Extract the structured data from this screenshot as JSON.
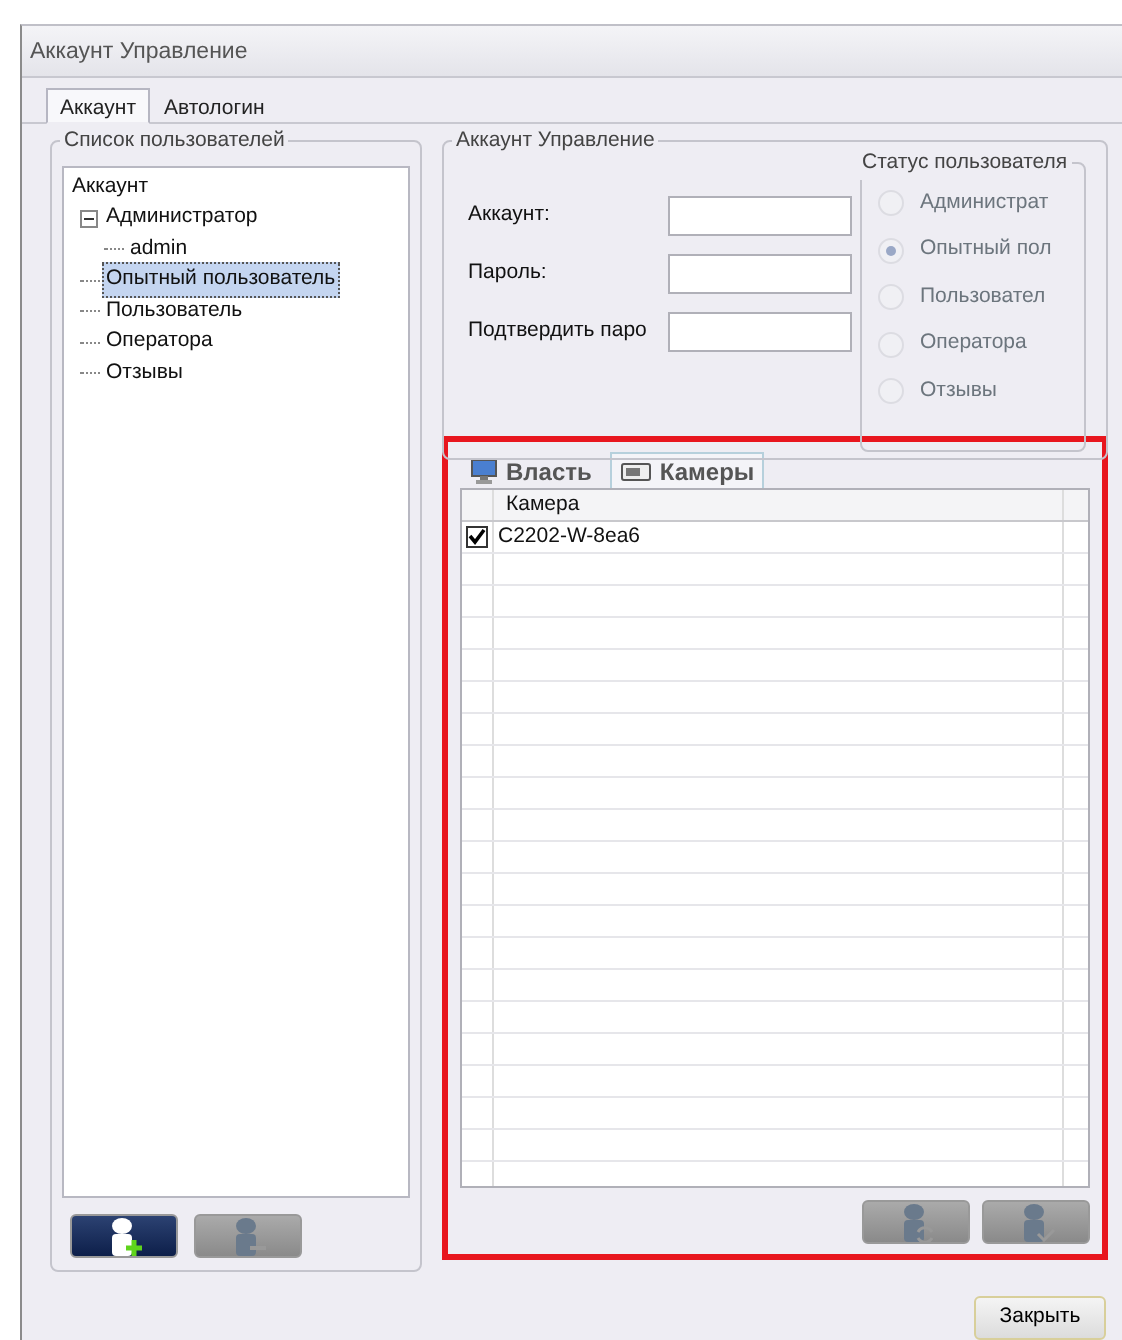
{
  "window": {
    "title": "Аккаунт Управление"
  },
  "tabs": [
    {
      "label": "Аккаунт",
      "selected": true
    },
    {
      "label": "Автологин",
      "selected": false
    }
  ],
  "user_list": {
    "title": "Список пользователей",
    "tree": [
      {
        "label": "Аккаунт",
        "selected": false,
        "children": [
          {
            "label": "Администратор",
            "selected": false,
            "expanded": true,
            "children": [
              {
                "label": "admin",
                "selected": false
              }
            ]
          },
          {
            "label": "Опытный пользователь",
            "selected": true
          },
          {
            "label": "Пользователь",
            "selected": false
          },
          {
            "label": "Оператора",
            "selected": false
          },
          {
            "label": "Отзывы",
            "selected": false
          }
        ]
      }
    ],
    "buttons": [
      {
        "kind": "add",
        "disabled": false
      },
      {
        "kind": "remove",
        "disabled": true
      }
    ]
  },
  "account": {
    "title": "Аккаунт Управление",
    "fields": [
      {
        "label": "Аккаунт:"
      },
      {
        "label": "Пароль:"
      },
      {
        "label": "Подтвердить паро"
      }
    ],
    "status": {
      "title": "Статус пользователя",
      "options": [
        {
          "label": "Администрат",
          "selected": false
        },
        {
          "label": "Опытный пол",
          "selected": true
        },
        {
          "label": "Пользовател",
          "selected": false
        },
        {
          "label": "Оператора",
          "selected": false
        },
        {
          "label": "Отзывы",
          "selected": false
        }
      ]
    }
  },
  "permissions": {
    "highlighted": true,
    "tabs": [
      {
        "kind": "monitor",
        "label": "Власть",
        "selected": false
      },
      {
        "kind": "camera",
        "label": "Камеры",
        "selected": true
      }
    ],
    "table": {
      "columns": [
        "Камера"
      ],
      "rows": [
        {
          "checked": true,
          "name": "C2202-W-8ea6"
        }
      ]
    },
    "buttons": [
      {
        "kind": "refresh",
        "disabled": true
      },
      {
        "kind": "confirm",
        "disabled": true
      }
    ]
  },
  "close_button": "Закрыть"
}
